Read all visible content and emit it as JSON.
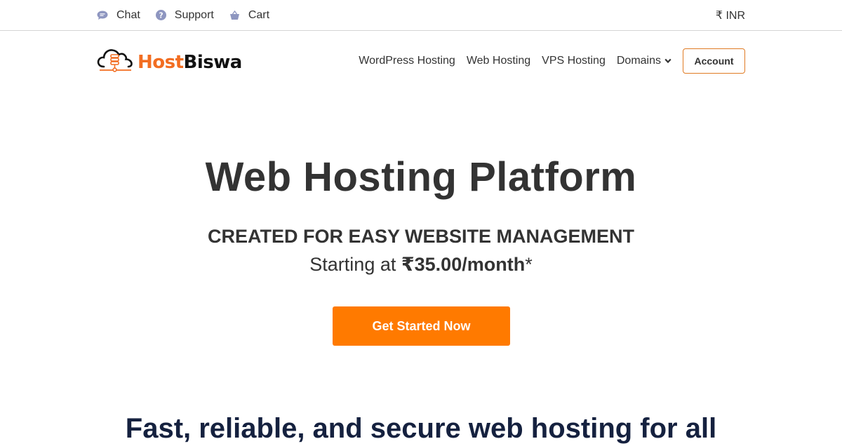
{
  "topbar": {
    "links": [
      {
        "label": "Chat",
        "icon": "chat-bubble-icon"
      },
      {
        "label": "Support",
        "icon": "question-circle-icon"
      },
      {
        "label": "Cart",
        "icon": "basket-icon"
      }
    ],
    "currency": "₹ INR"
  },
  "logo": {
    "part1": "Host",
    "part2": "Biswa",
    "icon": "cloud-server-icon"
  },
  "nav": {
    "items": [
      {
        "label": "WordPress Hosting"
      },
      {
        "label": "Web Hosting"
      },
      {
        "label": "VPS Hosting"
      },
      {
        "label": "Domains",
        "has_dropdown": true
      }
    ],
    "account_label": "Account"
  },
  "hero": {
    "title": "Web Hosting Platform",
    "subtitle": "CREATED FOR EASY WEBSITE MANAGEMENT",
    "price_prefix": "Starting at ",
    "price_value": "₹35.00/month",
    "price_suffix": "*",
    "cta_label": "Get Started Now"
  },
  "section": {
    "title": "Fast, reliable, and secure web hosting for all"
  },
  "colors": {
    "brand_orange": "#ff7a00",
    "logo_orange": "#f26d21",
    "heading_navy": "#15213f",
    "text_dark": "#333333",
    "icon_muted": "#8e96c0"
  }
}
